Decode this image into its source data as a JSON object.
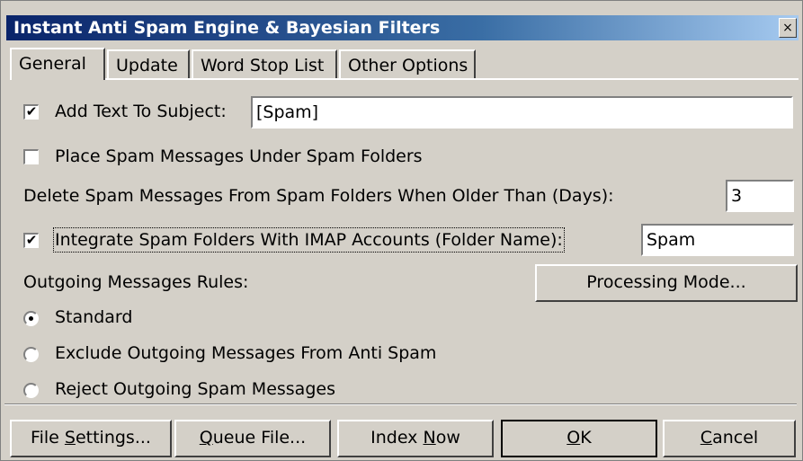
{
  "window": {
    "title": "Instant Anti Spam Engine & Bayesian Filters",
    "close_glyph": "×"
  },
  "tabs": [
    {
      "label": "General"
    },
    {
      "label": "Update"
    },
    {
      "label": "Word Stop List"
    },
    {
      "label": "Other Options"
    }
  ],
  "general": {
    "add_text": {
      "label": "Add Text To Subject:",
      "checked": true,
      "value": "[Spam]"
    },
    "place_spam": {
      "label": "Place Spam Messages Under Spam Folders",
      "checked": false
    },
    "delete_older": {
      "label": "Delete Spam Messages From Spam Folders When Older Than (Days):",
      "value": "3"
    },
    "integrate_imap": {
      "label": "Integrate Spam Folders With IMAP Accounts (Folder Name):",
      "checked": true,
      "value": "Spam"
    },
    "outgoing_rules_label": "Outgoing Messages Rules:",
    "processing_mode_button": "Processing Mode...",
    "outgoing_options": [
      {
        "label": "Standard",
        "selected": true
      },
      {
        "label": "Exclude Outgoing Messages From Anti Spam",
        "selected": false
      },
      {
        "label": "Reject Outgoing Spam Messages",
        "selected": false
      }
    ]
  },
  "buttons": {
    "file_settings": {
      "pre": "File ",
      "mn": "S",
      "post": "ettings..."
    },
    "queue_file": {
      "pre": "",
      "mn": "Q",
      "post": "ueue File..."
    },
    "index_now": {
      "pre": "Index ",
      "mn": "N",
      "post": "ow"
    },
    "ok": {
      "pre": "",
      "mn": "O",
      "post": "K"
    },
    "cancel": {
      "pre": "",
      "mn": "C",
      "post": "ancel"
    }
  },
  "check_glyph": "✔"
}
